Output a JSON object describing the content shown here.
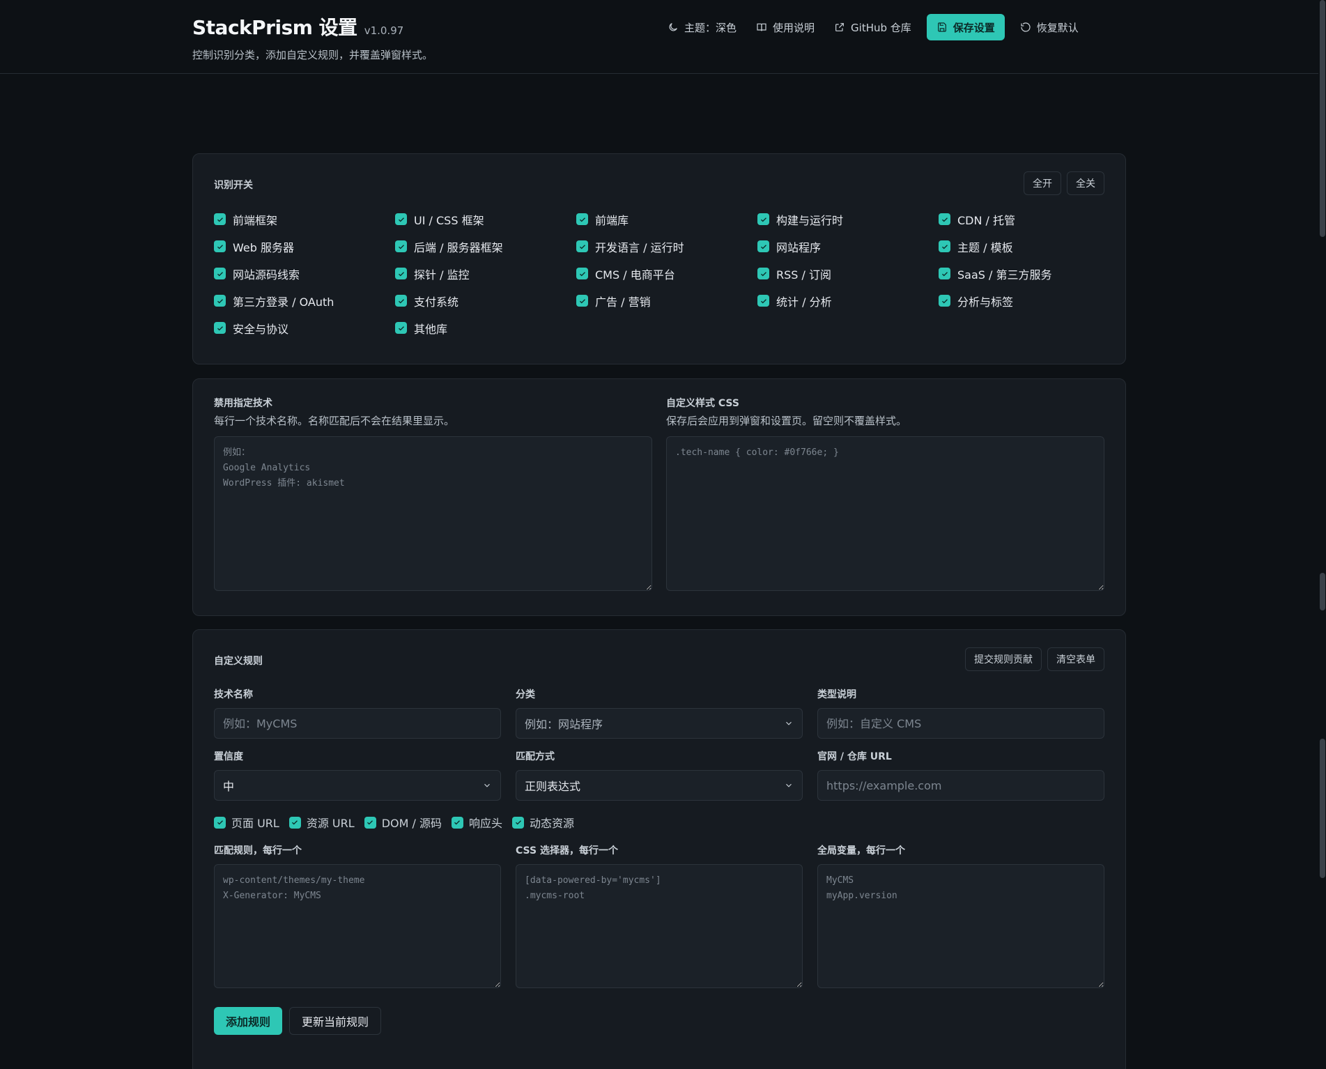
{
  "header": {
    "title": "StackPrism 设置",
    "version": "v1.0.97",
    "subtitle": "控制识别分类，添加自定义规则，并覆盖弹窗样式。",
    "buttons": {
      "theme": "主题：深色",
      "docs": "使用说明",
      "github": "GitHub 仓库",
      "save": "保存设置",
      "reset": "恢复默认"
    }
  },
  "colors": {
    "accent": "#2ec7b5",
    "background": "#0d1115",
    "card": "#161b21"
  },
  "toggles": {
    "title": "识别开关",
    "enable_all": "全开",
    "disable_all": "全关",
    "items": [
      {
        "label": "前端框架",
        "checked": true
      },
      {
        "label": "UI / CSS 框架",
        "checked": true
      },
      {
        "label": "前端库",
        "checked": true
      },
      {
        "label": "构建与运行时",
        "checked": true
      },
      {
        "label": "CDN / 托管",
        "checked": true
      },
      {
        "label": "Web 服务器",
        "checked": true
      },
      {
        "label": "后端 / 服务器框架",
        "checked": true
      },
      {
        "label": "开发语言 / 运行时",
        "checked": true
      },
      {
        "label": "网站程序",
        "checked": true
      },
      {
        "label": "主题 / 模板",
        "checked": true
      },
      {
        "label": "网站源码线索",
        "checked": true
      },
      {
        "label": "探针 / 监控",
        "checked": true
      },
      {
        "label": "CMS / 电商平台",
        "checked": true
      },
      {
        "label": "RSS / 订阅",
        "checked": true
      },
      {
        "label": "SaaS / 第三方服务",
        "checked": true
      },
      {
        "label": "第三方登录 / OAuth",
        "checked": true
      },
      {
        "label": "支付系统",
        "checked": true
      },
      {
        "label": "广告 / 营销",
        "checked": true
      },
      {
        "label": "统计 / 分析",
        "checked": true
      },
      {
        "label": "分析与标签",
        "checked": true
      },
      {
        "label": "安全与协议",
        "checked": true
      },
      {
        "label": "其他库",
        "checked": true
      }
    ]
  },
  "disabled_tech": {
    "title": "禁用指定技术",
    "desc": "每行一个技术名称。名称匹配后不会在结果里显示。",
    "placeholder": "例如：\nGoogle Analytics\nWordPress 插件: akismet"
  },
  "custom_css": {
    "title": "自定义样式 CSS",
    "desc": "保存后会应用到弹窗和设置页。留空则不覆盖样式。",
    "placeholder": ".tech-name { color: #0f766e; }"
  },
  "rules": {
    "title": "自定义规则",
    "submit_contrib": "提交规则贡献",
    "clear_form": "清空表单",
    "fields": {
      "tech_name": {
        "label": "技术名称",
        "placeholder": "例如：MyCMS"
      },
      "category": {
        "label": "分类",
        "value": "例如：网站程序"
      },
      "type_desc": {
        "label": "类型说明",
        "placeholder": "例如：自定义 CMS"
      },
      "confidence": {
        "label": "置信度",
        "value": "中"
      },
      "match_mode": {
        "label": "匹配方式",
        "value": "正则表达式"
      },
      "url": {
        "label": "官网 / 仓库 URL",
        "placeholder": "https://example.com"
      }
    },
    "sources": [
      {
        "label": "页面 URL",
        "checked": true
      },
      {
        "label": "资源 URL",
        "checked": true
      },
      {
        "label": "DOM / 源码",
        "checked": true
      },
      {
        "label": "响应头",
        "checked": true
      },
      {
        "label": "动态资源",
        "checked": true
      }
    ],
    "patterns": {
      "label": "匹配规则，每行一个",
      "placeholder": "wp-content/themes/my-theme\nX-Generator: MyCMS"
    },
    "selectors": {
      "label": "CSS 选择器，每行一个",
      "placeholder": "[data-powered-by='mycms']\n.mycms-root"
    },
    "globals": {
      "label": "全局变量，每行一个",
      "placeholder": "MyCMS\nmyApp.version"
    },
    "add_rule": "添加规则",
    "update_rule": "更新当前规则"
  }
}
